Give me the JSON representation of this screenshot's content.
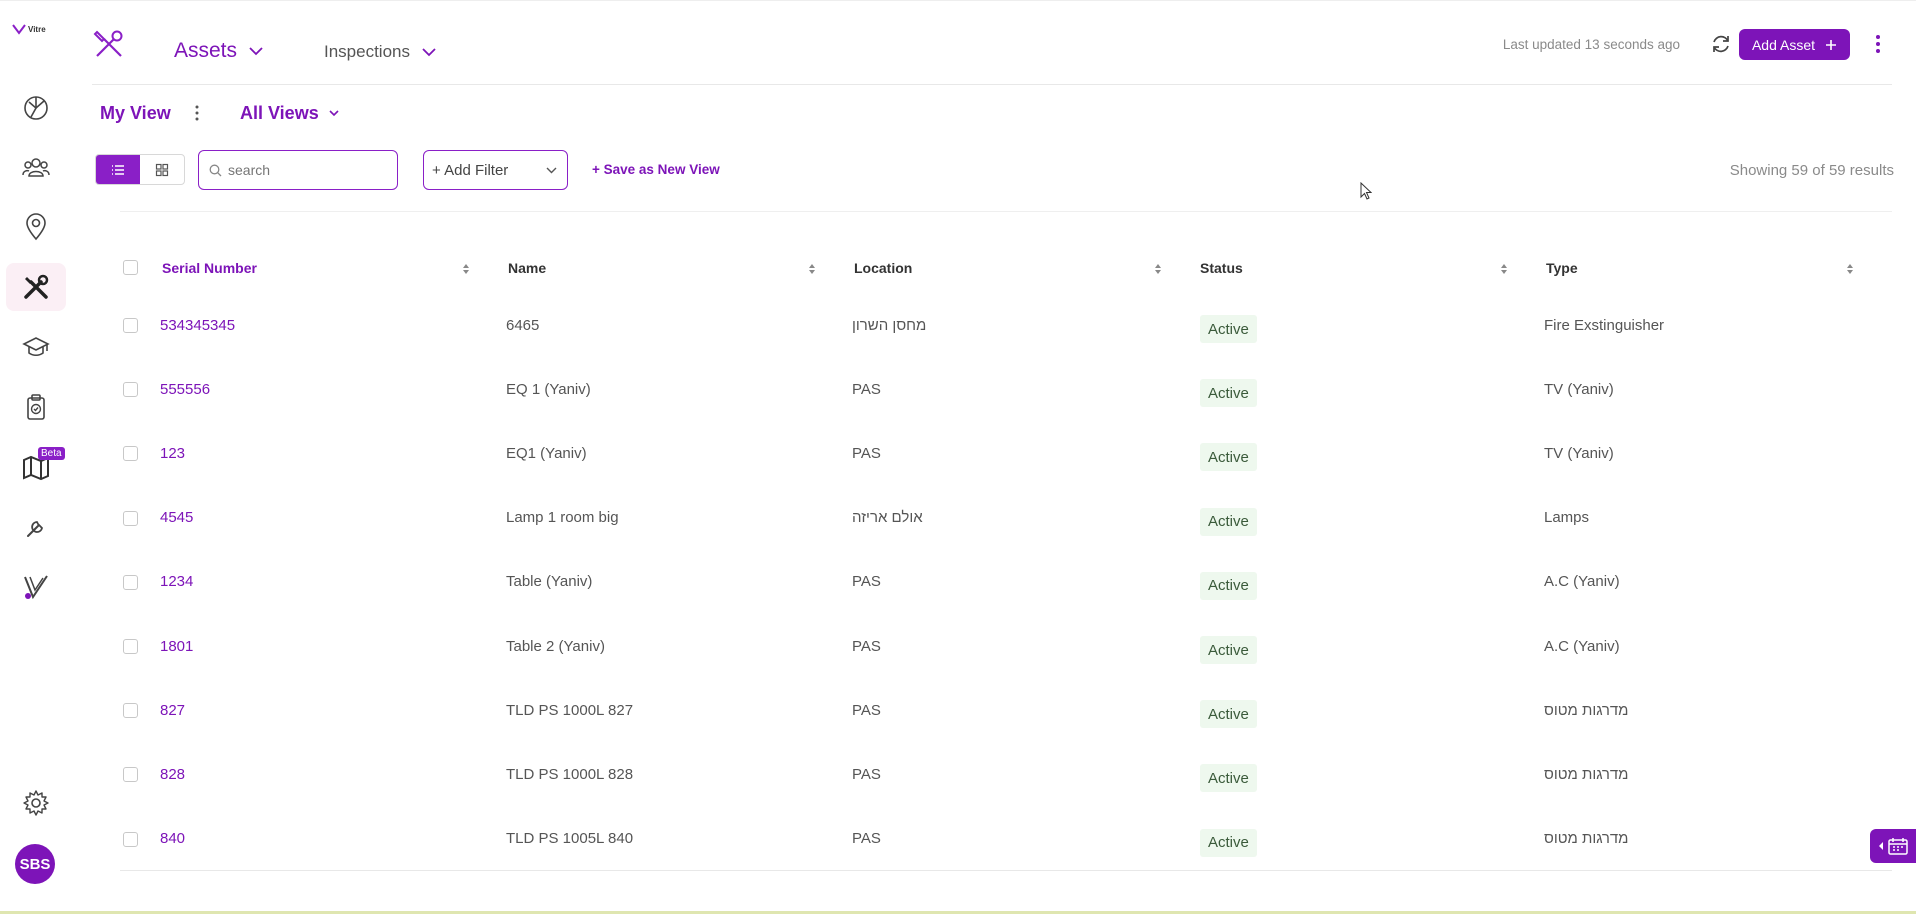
{
  "app": {
    "logo_text": "Vitre"
  },
  "sidebar": {
    "items": [
      {
        "name": "dashboard",
        "icon": "pie-chart-icon"
      },
      {
        "name": "people",
        "icon": "people-icon"
      },
      {
        "name": "locations",
        "icon": "location-pin-icon"
      },
      {
        "name": "assets",
        "icon": "tools-icon",
        "active": true
      },
      {
        "name": "training",
        "icon": "graduation-cap-icon"
      },
      {
        "name": "tasks",
        "icon": "clipboard-check-icon"
      },
      {
        "name": "maps",
        "icon": "map-icon",
        "badge": "Beta"
      },
      {
        "name": "maintenance",
        "icon": "wrench-icon"
      },
      {
        "name": "vitre",
        "icon": "vitre-v-icon"
      }
    ],
    "settings_icon": "gear-icon",
    "avatar_initials": "SBS"
  },
  "header": {
    "tabs": [
      {
        "label": "Assets",
        "active": true
      },
      {
        "label": "Inspections",
        "active": false
      }
    ],
    "last_updated_label": "Last updated",
    "last_updated_value": "13 seconds ago",
    "add_asset_label": "Add Asset"
  },
  "views": {
    "current": "My View",
    "all_views_label": "All Views"
  },
  "toolbar": {
    "search_placeholder": "search",
    "add_filter_label": "+ Add Filter",
    "save_view_label": "+ Save as New View",
    "showing_text": "Showing 59 of 59 results"
  },
  "table": {
    "columns": [
      "Serial Number",
      "Name",
      "Location",
      "Status",
      "Type"
    ],
    "rows": [
      {
        "serial": "534345345",
        "name": "6465",
        "location": "מחסן השרון",
        "status": "Active",
        "type": "Fire Exstinguisher"
      },
      {
        "serial": "555556",
        "name": "EQ 1 (Yaniv)",
        "location": "PAS",
        "status": "Active",
        "type": "TV (Yaniv)"
      },
      {
        "serial": "123",
        "name": "EQ1 (Yaniv)",
        "location": "PAS",
        "status": "Active",
        "type": "TV (Yaniv)"
      },
      {
        "serial": "4545",
        "name": "Lamp 1 room big",
        "location": "אולם אריזה",
        "status": "Active",
        "type": "Lamps"
      },
      {
        "serial": "1234",
        "name": "Table (Yaniv)",
        "location": "PAS",
        "status": "Active",
        "type": "A.C (Yaniv)"
      },
      {
        "serial": "1801",
        "name": "Table 2 (Yaniv)",
        "location": "PAS",
        "status": "Active",
        "type": "A.C (Yaniv)"
      },
      {
        "serial": "827",
        "name": "TLD PS 1000L 827",
        "location": "PAS",
        "status": "Active",
        "type": "מדרגות מטוס"
      },
      {
        "serial": "828",
        "name": "TLD PS 1000L 828",
        "location": "PAS",
        "status": "Active",
        "type": "מדרגות מטוס"
      },
      {
        "serial": "840",
        "name": "TLD PS 1005L 840",
        "location": "PAS",
        "status": "Active",
        "type": "מדרגות מטוס"
      }
    ]
  },
  "colors": {
    "brand": "#7d14b8",
    "status_bg": "#eef8ee"
  }
}
